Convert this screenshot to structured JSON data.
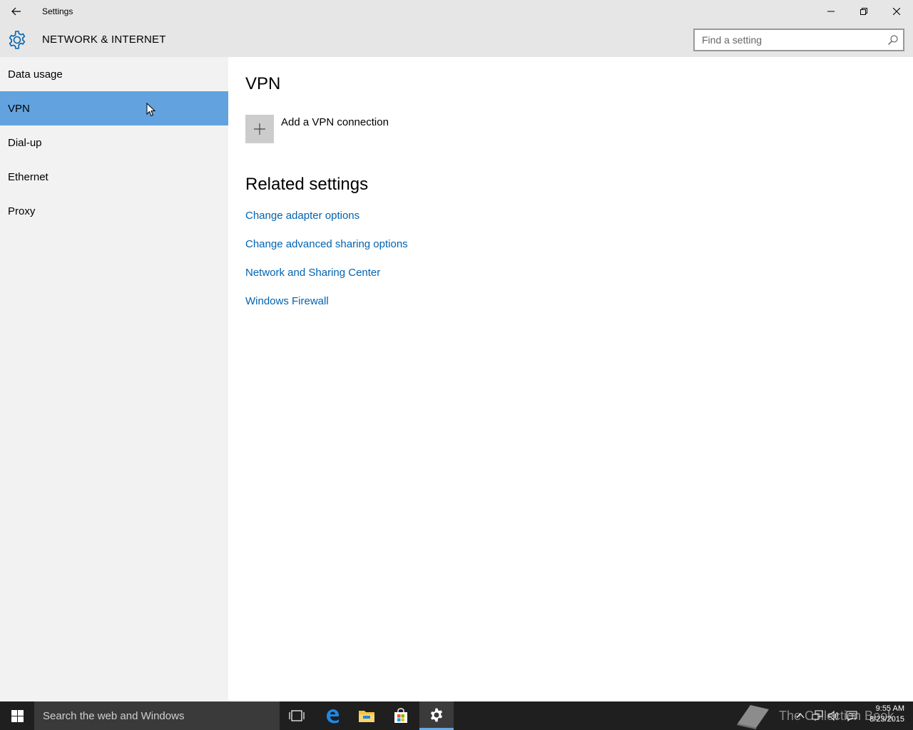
{
  "window": {
    "title": "Settings"
  },
  "header": {
    "section_title": "NETWORK & INTERNET",
    "search_placeholder": "Find a setting"
  },
  "sidebar": {
    "items": [
      {
        "label": "Data usage",
        "selected": false
      },
      {
        "label": "VPN",
        "selected": true
      },
      {
        "label": "Dial-up",
        "selected": false
      },
      {
        "label": "Ethernet",
        "selected": false
      },
      {
        "label": "Proxy",
        "selected": false
      }
    ]
  },
  "content": {
    "page_title": "VPN",
    "add_vpn_label": "Add a VPN connection",
    "related_title": "Related settings",
    "related_links": [
      "Change adapter options",
      "Change advanced sharing options",
      "Network and Sharing Center",
      "Windows Firewall"
    ]
  },
  "taskbar": {
    "search_placeholder": "Search the web and Windows",
    "watermark": "The Collection Book",
    "time": "9:55 AM",
    "date": "8/23/2015"
  },
  "colors": {
    "selected_nav": "#62a3df",
    "link": "#0063b1",
    "accent": "#0063b1"
  }
}
